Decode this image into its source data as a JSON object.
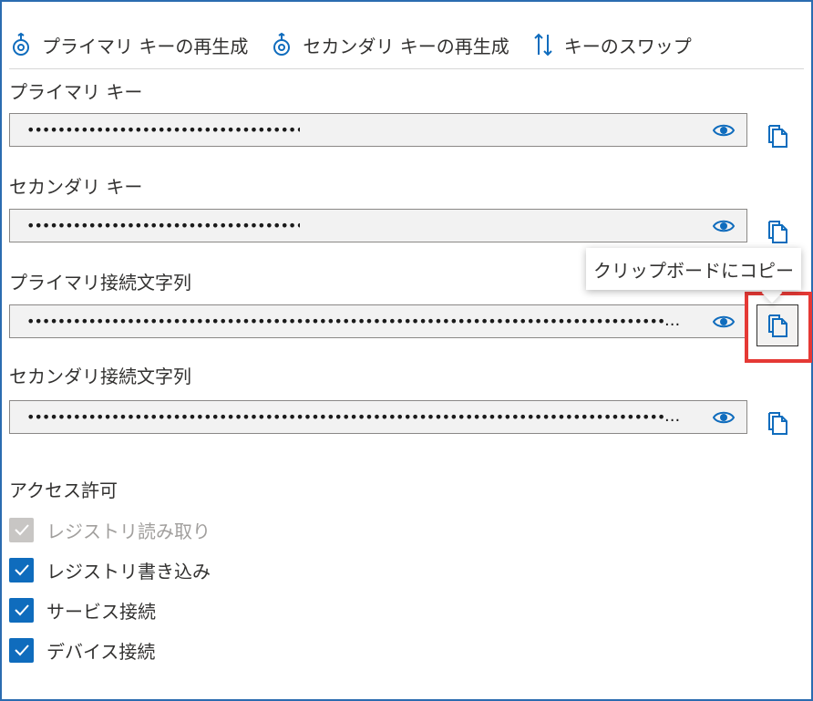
{
  "toolbar": {
    "regen_primary": "プライマリ キーの再生成",
    "regen_secondary": "セカンダリ キーの再生成",
    "swap_keys": "キーのスワップ"
  },
  "fields": {
    "primary_key": {
      "label": "プライマリ キー",
      "value": "•••••••••••••••••••••••••••••••••••••••••••••"
    },
    "secondary_key": {
      "label": "セカンダリ キー",
      "value": "•••••••••••••••••••••••••••••••••••••••••••••"
    },
    "primary_conn": {
      "label": "プライマリ接続文字列",
      "value": "•••••••••••••••••••••••••••••••••••••••••••••••••••••••••••••••••••••••••••••••••••••••••••••••••••••••••••••••••••••",
      "ellipsis": "..."
    },
    "secondary_conn": {
      "label": "セカンダリ接続文字列",
      "value": "•••••••••••••••••••••••••••••••••••••••••••••••••••••••••••••••••••••••••••••••••••••••••••••••••••••••••••••••••••••",
      "ellipsis": "..."
    }
  },
  "tooltip": {
    "text": "クリップボードにコピー"
  },
  "permissions": {
    "title": "アクセス許可",
    "items": [
      {
        "label": "レジストリ読み取り",
        "checked": true,
        "disabled": true
      },
      {
        "label": "レジストリ書き込み",
        "checked": true,
        "disabled": false
      },
      {
        "label": "サービス接続",
        "checked": true,
        "disabled": false
      },
      {
        "label": "デバイス接続",
        "checked": true,
        "disabled": false
      }
    ]
  },
  "colors": {
    "accent": "#0f6cbd",
    "highlight": "#e53935",
    "disabled": "#c8c6c4"
  }
}
